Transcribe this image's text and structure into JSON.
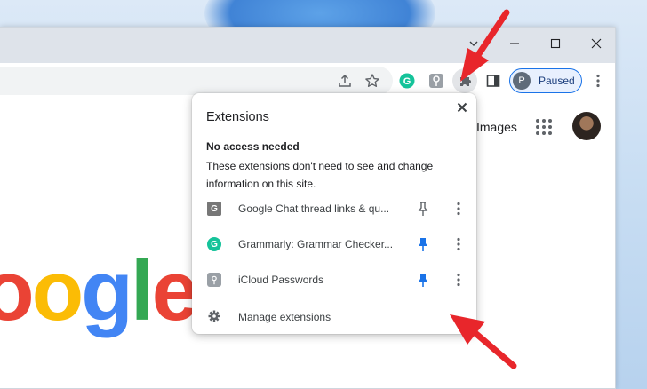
{
  "toolbar": {
    "profile": {
      "initial": "P",
      "label": "Paused"
    }
  },
  "page": {
    "images_link": "Images",
    "logo_letters": [
      {
        "ch": "o",
        "color": "#ea4335"
      },
      {
        "ch": "o",
        "color": "#fbbc05"
      },
      {
        "ch": "g",
        "color": "#4285f4"
      },
      {
        "ch": "l",
        "color": "#34a853"
      },
      {
        "ch": "e",
        "color": "#ea4335"
      }
    ]
  },
  "popup": {
    "title": "Extensions",
    "section_heading": "No access needed",
    "section_description": "These extensions don't need to see and change information on this site.",
    "extensions": [
      {
        "name": "Google Chat thread links & qu...",
        "icon": "google-chat-links-icon",
        "icon_letter": "G",
        "pinned": false
      },
      {
        "name": "Grammarly: Grammar Checker...",
        "icon": "grammarly-icon",
        "icon_letter": "G",
        "pinned": true
      },
      {
        "name": "iCloud Passwords",
        "icon": "icloud-passwords-icon",
        "icon_letter": "",
        "pinned": true
      }
    ],
    "manage_label": "Manage extensions"
  },
  "colors": {
    "accent": "#1a73e8",
    "annotation_arrow": "#e8262b",
    "grammarly": "#15c39a"
  }
}
